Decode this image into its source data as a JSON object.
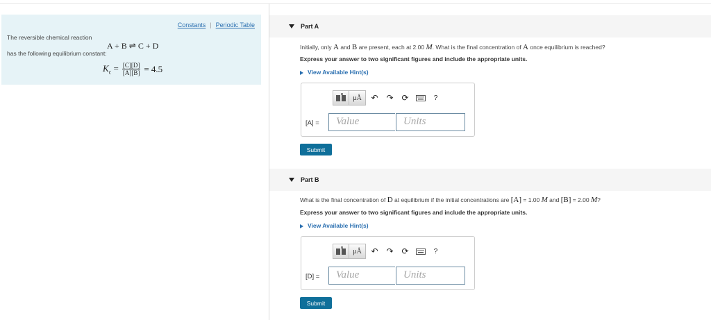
{
  "info": {
    "links": {
      "constants": "Constants",
      "separator": "|",
      "periodic_table": "Periodic Table"
    },
    "intro": "The reversible chemical reaction",
    "reaction": "A + B ⇌ C + D",
    "constant_text": "has the following equilibrium constant:",
    "kc": {
      "symbol": "K",
      "subscript": "c",
      "numerator": "[C][D]",
      "denominator": "[A][B]",
      "value": "= 4.5"
    }
  },
  "partA": {
    "title": "Part A",
    "q1": "Initially, only ",
    "qA": "A",
    "q2": " and ",
    "qB": "B",
    "q3": " are present, each at 2.00 ",
    "qM": "M",
    "q4": ". What is the final concentration of ",
    "qA2": "A",
    "q5": " once equilibrium is reached?",
    "express": "Express your answer to two significant figures and include the appropriate units.",
    "hint": "View Available Hint(s)",
    "variable": "[A] =",
    "value_placeholder": "Value",
    "units_placeholder": "Units",
    "submit": "Submit"
  },
  "partB": {
    "title": "Part B",
    "q1": "What is the final concentration of ",
    "qD": "D",
    "q2": " at equilibrium if the initial concentrations are ",
    "qA": "[A]",
    "q3": " = 1.00 ",
    "qM": "M",
    "q4": " and ",
    "qB": "[B]",
    "q5": " = 2.00 ",
    "qM2": "M",
    "q6": "?",
    "express": "Express your answer to two significant figures and include the appropriate units.",
    "hint": "View Available Hint(s)",
    "variable": "[D] =",
    "value_placeholder": "Value",
    "units_placeholder": "Units",
    "submit": "Submit"
  },
  "toolbar": {
    "mu_label": "μÅ",
    "help_label": "?",
    "icons": [
      "templates-icon",
      "units-icon",
      "undo-icon",
      "redo-icon",
      "reset-icon",
      "keyboard-icon",
      "help-icon"
    ]
  },
  "colors": {
    "info_bg": "#e6f3f7",
    "link": "#2a6fb0",
    "submit": "#0f6f9a",
    "part_header": "#f5f5f5"
  }
}
